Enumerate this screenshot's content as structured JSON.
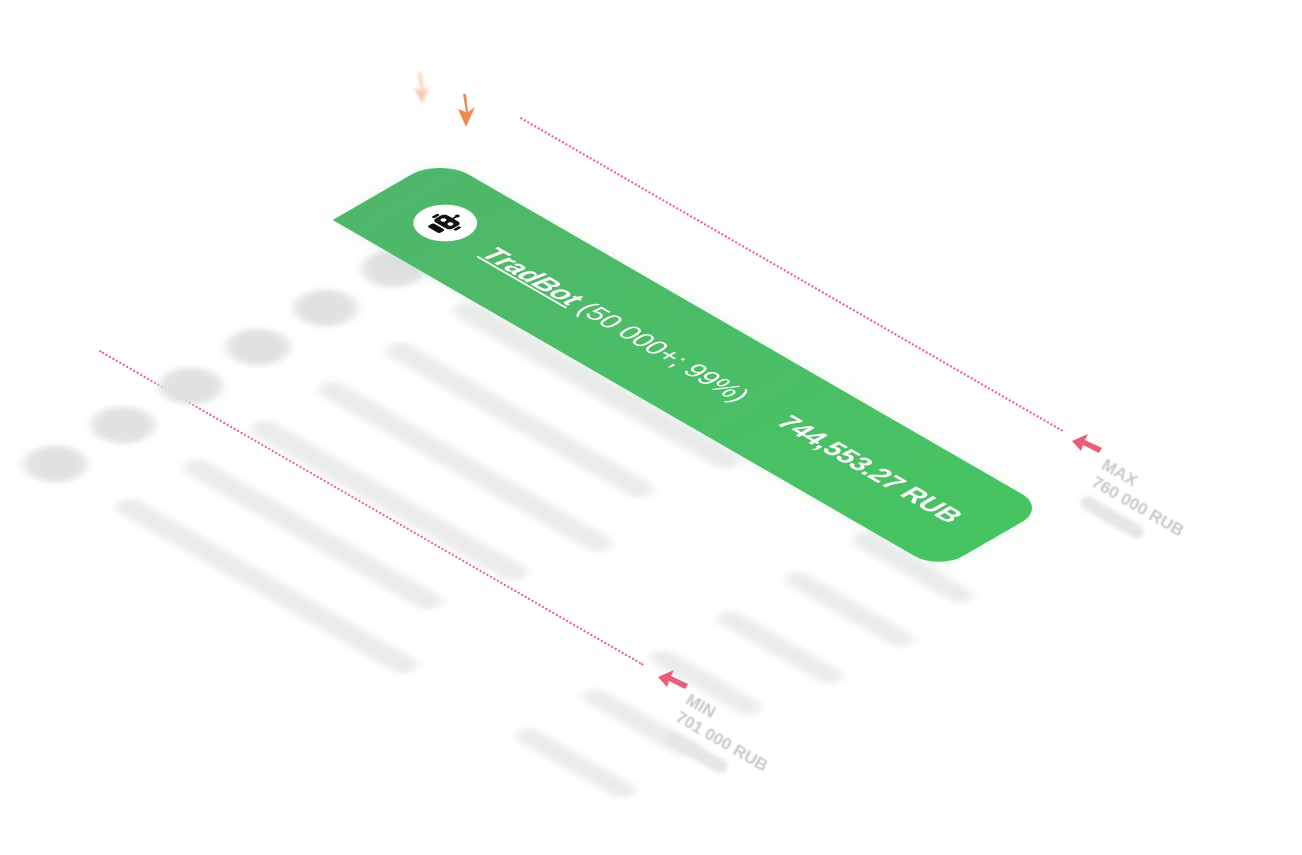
{
  "card": {
    "bot_name": "TradBot",
    "bot_stats": "(50 000+; 99%)",
    "amount": "744,553.27 RUB",
    "color": "#46c462"
  },
  "max_marker": {
    "label": "MAX",
    "value": "760 000 RUB"
  },
  "min_marker": {
    "label": "MIN",
    "value": "701 000 RUB"
  },
  "colors": {
    "accent_green": "#46c462",
    "pointer_orange": "#ef8a4e",
    "marker_pink": "#ec5b79",
    "blurred_gray": "#e4e4e4"
  },
  "icons": {
    "bot_logo": "robot-icon",
    "orange_pointer": "arrow-down-icon",
    "marker_arrow": "arrow-left-icon"
  }
}
